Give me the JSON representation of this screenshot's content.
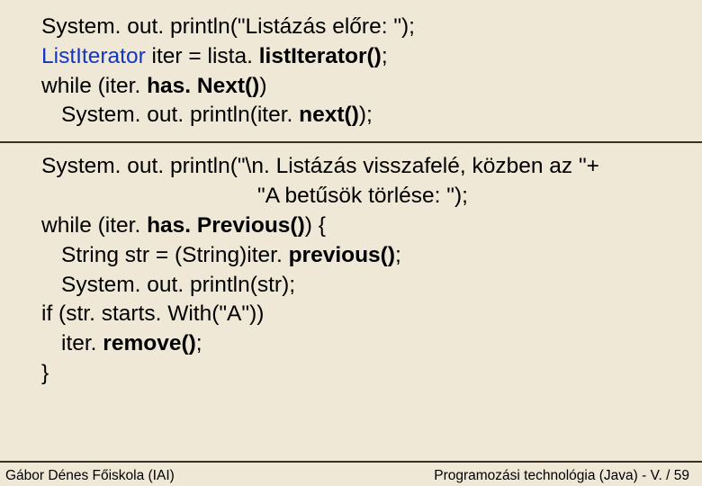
{
  "code": {
    "l1a": "System. out. println(\"Listázás előre: \");",
    "l2a": "ListIterator",
    "l2b": " iter = lista. ",
    "l2c": "listIterator()",
    "l2d": ";",
    "l3a": "while (iter. ",
    "l3b": "has. Next()",
    "l3c": ")",
    "l4a": "System. out. println(iter. ",
    "l4b": "next()",
    "l4c": ");",
    "l5a": "System. out. println(\"\\n. Listázás visszafelé, közben az \"+",
    "l6a": "\"A betűsök törlése: \");",
    "l7a": "while (iter. ",
    "l7b": "has. Previous()",
    "l7c": ") {",
    "l8a": "String str = (String)iter. ",
    "l8b": "previous()",
    "l8c": ";",
    "l9a": "System. out. println(str);",
    "l10a": "if (str. starts. With(\"A\"))",
    "l11a": "iter. ",
    "l11b": "remove()",
    "l11c": ";",
    "l12a": "}"
  },
  "footer": {
    "left": "Gábor Dénes Főiskola (IAI)",
    "right": "Programozási technológia (Java)  -  V. / 59"
  }
}
